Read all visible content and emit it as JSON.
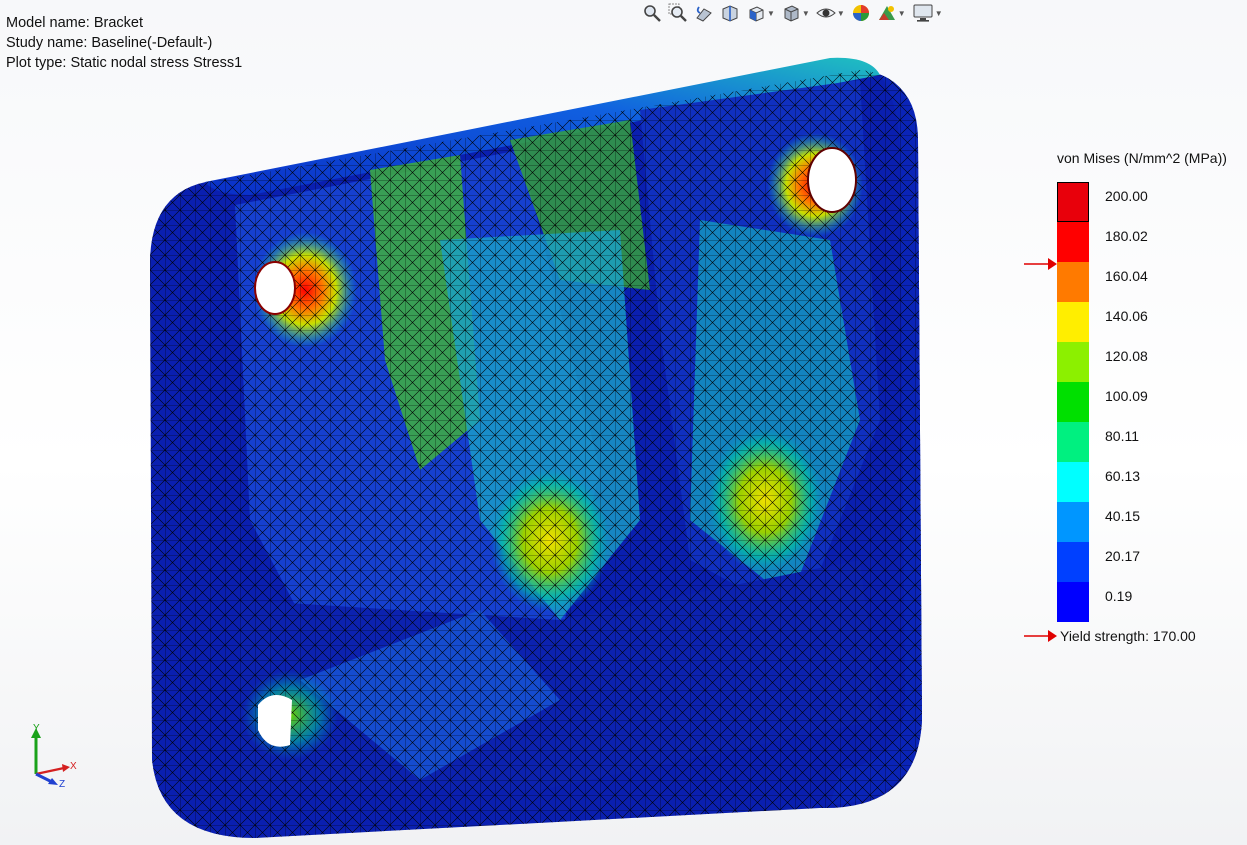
{
  "info": {
    "model_line": "Model name: Bracket",
    "study_line": "Study name: Baseline(-Default-)",
    "plot_line": "Plot type: Static nodal stress Stress1"
  },
  "toolbar": {
    "buttons": [
      {
        "icon": "zoom-to-fit-icon"
      },
      {
        "icon": "zoom-to-area-icon"
      },
      {
        "icon": "previous-view-icon"
      },
      {
        "icon": "section-view-icon"
      },
      {
        "icon": "view-orientation-icon",
        "dropdown": true
      },
      {
        "icon": "display-style-icon",
        "dropdown": true
      },
      {
        "icon": "hide-show-items-icon",
        "dropdown": true
      },
      {
        "icon": "edit-appearance-icon"
      },
      {
        "icon": "apply-scene-icon",
        "dropdown": true
      },
      {
        "icon": "view-settings-icon",
        "dropdown": true
      }
    ]
  },
  "legend": {
    "title": "von Mises (N/mm^2 (MPa))",
    "labels": [
      "200.00",
      "180.02",
      "160.04",
      "140.06",
      "120.08",
      "100.09",
      "80.11",
      "60.13",
      "40.15",
      "20.17",
      "0.19"
    ],
    "colors": [
      "#e8000b",
      "#ff0000",
      "#ff7a00",
      "#ffee00",
      "#8cf000",
      "#00e000",
      "#00f080",
      "#00ffff",
      "#0096ff",
      "#0040ff",
      "#0000ff"
    ],
    "yield_label": "Yield strength: 170.00",
    "marker_color": "#e00000"
  },
  "triad": {
    "y_label": "Y",
    "x_label": "X",
    "z_label": "Z"
  },
  "colors": {
    "mesh_base": "#0a1fb0",
    "mesh_edge": "#000000",
    "background": "#ffffff"
  }
}
